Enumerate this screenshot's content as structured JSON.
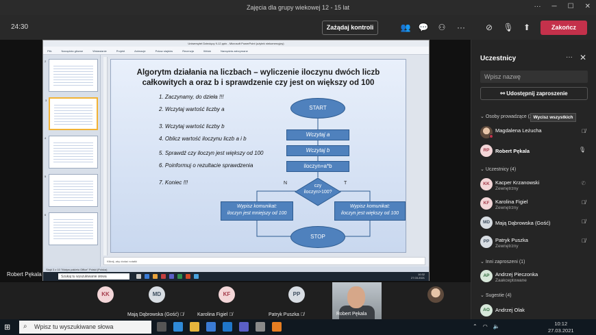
{
  "window": {
    "title": "Zajęcia dla grupy wiekowej 12 - 15 lat"
  },
  "meeting": {
    "timer": "24:30",
    "control_label": "Zażądaj kontroli",
    "leave_label": "Zakończ"
  },
  "ppt": {
    "title": "Uniwersytet Dziecięcy 9-12.pptx - Microsoft PowerPoint (użytek niekomercyjny)",
    "ribbon": [
      "Plik",
      "Narzędzia główne",
      "Wstawianie",
      "Projekt",
      "Animacje",
      "Pokaz slajdów",
      "Recenzja",
      "Widok",
      "Narzędzia zatrzymane"
    ],
    "notes_placeholder": "Kliknij, aby dodać notatki",
    "status": "Slajd 3 z 10   \"Motyw pakietu Office\"   Polski (Polska)",
    "thumb_numbers": [
      "2",
      "3",
      "4",
      "5",
      "6"
    ],
    "inner_search": "Szukaj tu wyszukiwanie słowa",
    "inner_clock_time": "10:32",
    "inner_clock_date": "27.03.2021"
  },
  "slide": {
    "title_line1": "Algorytm działania na liczbach – wyliczenie iloczynu dwóch liczb",
    "title_line2": "całkowitych a oraz b i sprawdzenie czy jest on większy od 100",
    "steps": [
      "1. Zaczynamy, do dzieła !!!",
      "2. Wczytaj wartość liczby a",
      "3. Wczytaj wartość liczby b",
      "4. Oblicz wartość iloczynu liczb a i b",
      "5. Sprawdź czy iloczyn jest większy od 100",
      "6. Poinformuj o rezultacie sprawdzenia",
      "7. Koniec !!!"
    ],
    "flow": {
      "start": "START",
      "read_a": "Wczytaj  a",
      "read_b": "Wczytaj b",
      "calc": "iloczyn=a*b",
      "decision_1": "czy",
      "decision_2": "iloczyn>100?",
      "no": "N",
      "yes": "T",
      "left_1": "Wypisz komunikat:",
      "left_2": "iloczyn jest mniejszy od 100",
      "right_1": "Wypisz komunikat:",
      "right_2": "iloczyn jest większy od 100",
      "stop": "STOP"
    }
  },
  "presenter_label": "Robert Pękala",
  "panel": {
    "title": "Uczestnicy",
    "search_placeholder": "Wpisz nazwę",
    "invite_label": "Udostępnij zaproszenie",
    "mute_all_label": "Wycisz wszystkich",
    "sections": {
      "presenters": "Osoby prowadzące (2)",
      "participants": "Uczestnicy (4)",
      "invited": "Inni zaproszeni (1)",
      "suggestions": "Sugestie (4)"
    },
    "presenters": [
      {
        "name": "Magdalena Leżucha"
      },
      {
        "initials": "RP",
        "name": "Robert Pękala"
      }
    ],
    "participants": [
      {
        "initials": "KK",
        "name": "Kacper Krzanowski",
        "sub": "Zewnętrzny"
      },
      {
        "initials": "KF",
        "name": "Karolina Figiel",
        "sub": "Zewnętrzny"
      },
      {
        "initials": "MD",
        "name": "Mają Dąbrowska (Gość)",
        "sub": ""
      },
      {
        "initials": "PP",
        "name": "Patryk Puszka",
        "sub": "Zewnętrzny"
      }
    ],
    "invited": [
      {
        "initials": "AP",
        "name": "Andrzej Pieczonka",
        "sub": "Zaakceptowane"
      }
    ],
    "suggestions": [
      {
        "initials": "AO",
        "name": "Andrzej Olak"
      }
    ]
  },
  "gallery": [
    {
      "initials": "KK",
      "name": ""
    },
    {
      "initials": "MD",
      "name": "Mają Dąbrowska (Gość)"
    },
    {
      "initials": "KF",
      "name": "Karolina Figiel"
    },
    {
      "initials": "PP",
      "name": "Patryk Puszka"
    }
  ],
  "video_name": "Robert Pękala",
  "taskbar": {
    "search_placeholder": "Wpisz tu wyszukiwane słowa",
    "time": "10:12",
    "date": "27.03.2021"
  },
  "colors": {
    "accent": "#4f81bd",
    "leave": "#c4314b",
    "panel": "#252525"
  }
}
